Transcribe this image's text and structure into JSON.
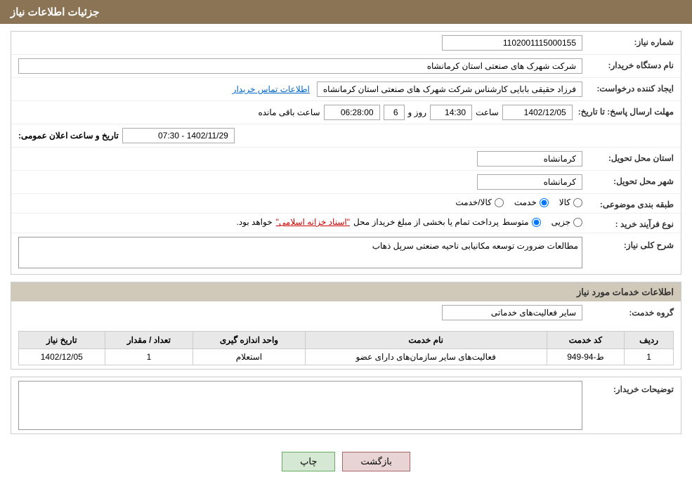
{
  "header": {
    "title": "جزئیات اطلاعات نیاز"
  },
  "fields": {
    "need_number_label": "شماره نیاز:",
    "need_number_value": "1102001115000155",
    "buyer_org_label": "نام دستگاه خریدار:",
    "buyer_org_value": "شرکت شهرک های صنعتی استان کرمانشاه",
    "creator_label": "ایجاد کننده درخواست:",
    "creator_value": "فرزاد حقیقی بابایی کارشناس شرکت شهرک های صنعتی استان کرمانشاه",
    "contact_link": "اطلاعات تماس خریدار",
    "deadline_label": "مهلت ارسال پاسخ: تا تاریخ:",
    "date_label": "تاریخ و ساعت اعلان عمومی:",
    "announcement_date": "1402/11/29 - 07:30",
    "response_date": "1402/12/05",
    "response_time_label": "ساعت",
    "response_time": "14:30",
    "days_label": "روز و",
    "days_value": "6",
    "remaining_label": "ساعت باقی مانده",
    "remaining_time": "06:28:00",
    "province_label": "استان محل تحویل:",
    "province_value": "کرمانشاه",
    "city_label": "شهر محل تحویل:",
    "city_value": "کرمانشاه",
    "category_label": "طبقه بندی موضوعی:",
    "category_options": [
      "کالا",
      "خدمت",
      "کالا/خدمت"
    ],
    "category_selected": "خدمت",
    "purchase_type_label": "نوع فرآیند خرید :",
    "purchase_options": [
      "جزیی",
      "متوسط"
    ],
    "purchase_note": "پرداخت تمام یا بخشی از مبلغ خریداز محل",
    "purchase_highlight": "\"اسناد خزانه اسلامی\"",
    "purchase_suffix": "خواهد بود.",
    "description_label": "شرح کلی نیاز:",
    "description_value": "مطالعات ضرورت توسعه مکانیابی ناحیه صنعتی سرپل ذهاب"
  },
  "services_section": {
    "title": "اطلاعات خدمات مورد نیاز",
    "group_label": "گروه خدمت:",
    "group_value": "سایر فعالیت‌های خدماتی",
    "table": {
      "headers": [
        "ردیف",
        "کد خدمت",
        "نام خدمت",
        "واحد اندازه گیری",
        "تعداد / مقدار",
        "تاریخ نیاز"
      ],
      "rows": [
        {
          "row": "1",
          "code": "ط-94-949",
          "name": "فعالیت‌های سایر سازمان‌های دارای عضو",
          "unit": "استعلام",
          "quantity": "1",
          "date": "1402/12/05"
        }
      ]
    }
  },
  "buyer_notes_label": "توضیحات خریدار:",
  "buyer_notes_value": "",
  "buttons": {
    "print": "چاپ",
    "back": "بازگشت"
  }
}
